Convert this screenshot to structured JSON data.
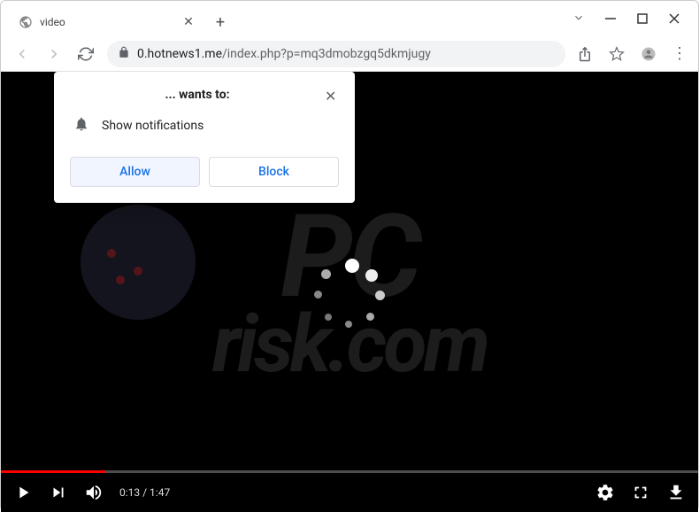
{
  "window": {
    "tab_title": "video"
  },
  "toolbar": {
    "url_domain": "0.hotnews1.me",
    "url_path": "/index.php?p=mq3dmobzgq5dkmjugy"
  },
  "permission": {
    "title": "... wants to:",
    "message": "Show notifications",
    "allow_label": "Allow",
    "block_label": "Block"
  },
  "video": {
    "current_time": "0:13",
    "duration": "1:47",
    "time_display": "0:13 / 1:47"
  },
  "watermark": {
    "line1": "PC",
    "line2": "risk.com"
  }
}
